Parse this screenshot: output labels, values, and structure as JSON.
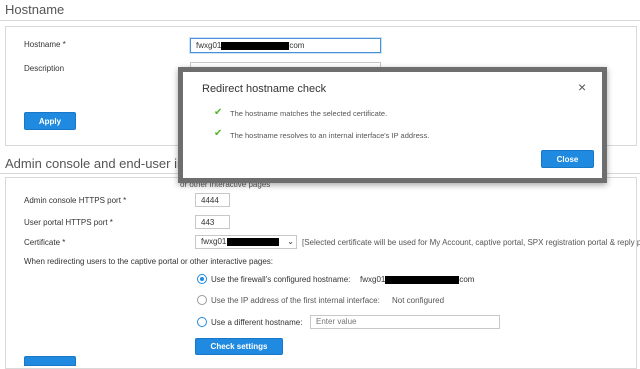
{
  "hostname_section": {
    "title": "Hostname",
    "hostname_label": "Hostname *",
    "hostname_value_prefix": "fwxg01",
    "hostname_value_suffix": "com",
    "description_label": "Description",
    "apply_label": "Apply"
  },
  "admin_section": {
    "title": "Admin console and end-user interaction",
    "partial_text": "or other interactive pages",
    "admin_port_label": "Admin console HTTPS port *",
    "admin_port_value": "4444",
    "user_port_label": "User portal HTTPS port *",
    "user_port_value": "443",
    "certificate_label": "Certificate *",
    "certificate_value_prefix": "fwxg01",
    "certificate_note": "[Selected certificate will be used for My Account, captive portal, SPX registration portal & reply port",
    "redirect_text": "When redirecting users to the captive portal or other interactive pages:",
    "options": [
      {
        "label": "Use the firewall's configured hostname:",
        "value_prefix": "fwxg01",
        "value_suffix": "com",
        "selected": true
      },
      {
        "label": "Use the IP address of the first internal interface:",
        "value": "Not configured",
        "selected": false
      },
      {
        "label": "Use a different hostname:",
        "placeholder": "Enter value",
        "selected": false
      }
    ],
    "check_settings_label": "Check settings"
  },
  "modal": {
    "title": "Redirect hostname check",
    "messages": [
      "The hostname matches the selected certificate.",
      "The hostname resolves to an internal interface's IP address."
    ],
    "close_label": "Close",
    "close_icon": "×",
    "check_icon": "✔"
  },
  "colors": {
    "primary": "#1f8ae0",
    "success": "#55b32e",
    "modal_border": "#6e6e6e"
  }
}
